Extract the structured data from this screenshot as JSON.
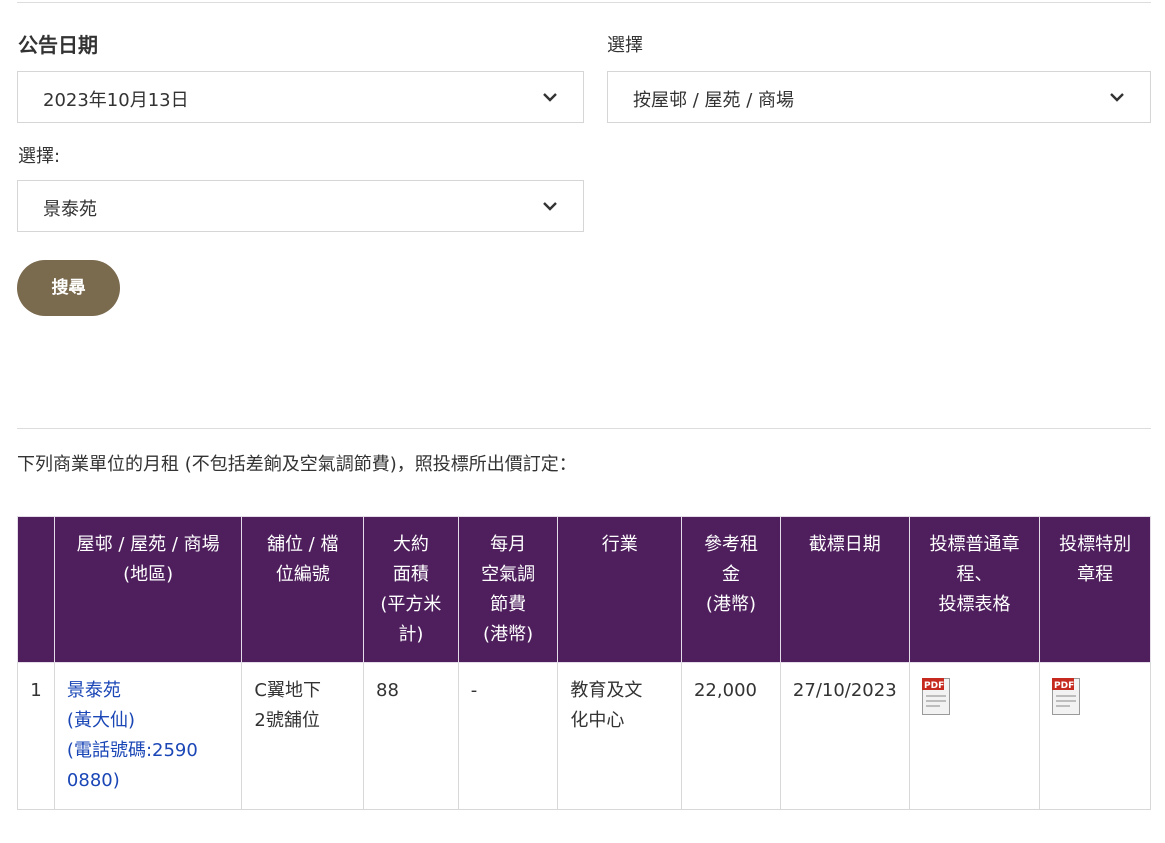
{
  "filters": {
    "date_label": "公告日期",
    "date_value": "2023年10月13日",
    "type_label": "選擇",
    "type_value": "按屋邨 / 屋苑 / 商場",
    "estate_label": "選擇:",
    "estate_value": "景泰苑",
    "search_label": "搜尋"
  },
  "intro_text": "下列商業單位的月租 (不包括差餉及空氣調節費)，照投標所出價訂定：",
  "table": {
    "headers": [
      "",
      "屋邨 / 屋苑 / 商場\n(地區)",
      "舖位 / 檔\n位編號",
      "大約\n面積\n(平方米\n計)",
      "每月\n空氣調\n節費\n(港幣)",
      "行業",
      "參考租\n金\n(港幣)",
      "截標日期",
      "投標普通章\n程、\n投標表格",
      "投標特別\n章程"
    ],
    "rows": [
      {
        "index": "1",
        "estate_name": "景泰苑",
        "district": "(黃大仙)",
        "phone": "(電話號碼:2590\n0880)",
        "shop_no": "C翼地下\n2號舖位",
        "area": "88",
        "ac_fee": "-",
        "trade": "教育及文\n化中心",
        "rent": "22,000",
        "closing_date": "27/10/2023",
        "general_doc_icon": "pdf-icon",
        "special_doc_icon": "pdf-icon"
      }
    ]
  },
  "colors": {
    "header_bg": "#4e1f5c",
    "button_bg": "#7a6a4e",
    "link": "#1a46b6"
  }
}
